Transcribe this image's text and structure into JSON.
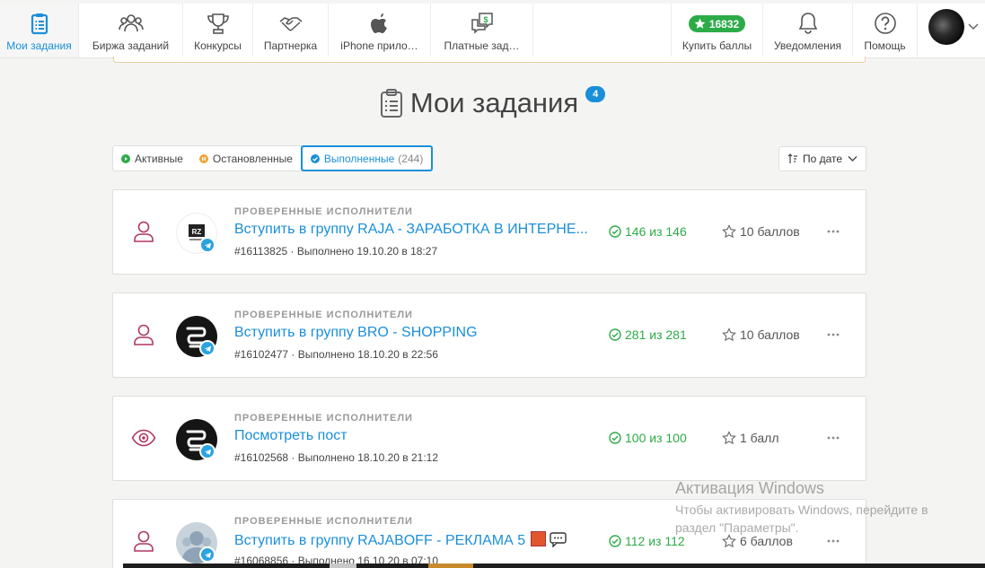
{
  "nav": {
    "items": [
      {
        "label": "Мои задания",
        "icon": "clipboard-icon"
      },
      {
        "label": "Биржа заданий",
        "icon": "users-icon"
      },
      {
        "label": "Конкурсы",
        "icon": "trophy-icon"
      },
      {
        "label": "Партнерка",
        "icon": "handshake-icon"
      },
      {
        "label": "iPhone прило…",
        "icon": "apple-icon"
      },
      {
        "label": "Платные зад…",
        "icon": "paid-chat-icon"
      }
    ],
    "right": {
      "points": "16832",
      "buy_label": "Купить баллы",
      "notifications_label": "Уведомления",
      "help_label": "Помощь"
    }
  },
  "page": {
    "title": "Мои задания",
    "title_badge": "4"
  },
  "filters": {
    "active_label": "Активные",
    "stopped_label": "Остановленные",
    "done_label": "Выполненные",
    "done_count": "(244)"
  },
  "sort": {
    "label": "По дате"
  },
  "tasks": [
    {
      "kicker": "Проверенные исполнители",
      "title": "Вступить в группу RAJA - ЗАРАБОТКА В ИНТЕРНЕ...",
      "id": "#16113825",
      "completed": "Выполнено 19.10.20 в 18:27",
      "progress": "146 из 146",
      "reward": "10 баллов",
      "type": "user-icon",
      "logo": "raja"
    },
    {
      "kicker": "Проверенные исполнители",
      "title": "Вступить в группу BRO - SHOPPING",
      "id": "#16102477",
      "completed": "Выполнено 18.10.20 в 22:56",
      "progress": "281 из 281",
      "reward": "10 баллов",
      "type": "user-icon",
      "logo": "bro"
    },
    {
      "kicker": "Проверенные исполнители",
      "title": "Посмотреть пост",
      "id": "#16102568",
      "completed": "Выполнено 18.10.20 в 21:12",
      "progress": "100 из 100",
      "reward": "1 балл",
      "type": "eye-icon",
      "logo": "bro"
    },
    {
      "kicker": "Проверенные исполнители",
      "title": "Вступить в группу RAJABOFF - РЕКЛАМА 5",
      "id": "#16068856",
      "completed": "Выполнено 16.10.20 в 07:10",
      "progress": "112 из 112",
      "reward": "6 баллов",
      "type": "user-icon",
      "logo": "rajaboff"
    }
  ],
  "watermark": {
    "heading": "Активация Windows",
    "text": "Чтобы активировать Windows, перейдите в раздел \"Параметры\"."
  },
  "colors": {
    "accent": "#1a8fd9",
    "success": "#2cab48",
    "type_icon": "#b0365f",
    "telegram": "#2aa3df"
  }
}
